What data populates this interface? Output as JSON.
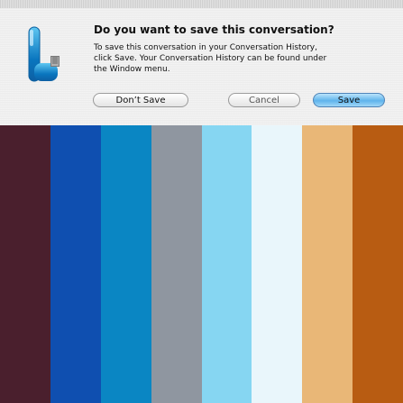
{
  "window": {
    "titlebar_text": ""
  },
  "dialog": {
    "title": "Do you want to save this conversation?",
    "body_line1": "To save this conversation in your Conversation History,",
    "body_line2": "click Save.  Your Conversation History can be found under",
    "body_line3": "the Window menu.",
    "buttons": {
      "dont_save": "Don’t Save",
      "cancel": "Cancel",
      "save": "Save"
    },
    "icon": "ichat-app-icon"
  },
  "background_stripes": {
    "colors": [
      "#4a1f2d",
      "#0f4fb0",
      "#0a86c3",
      "#8f96a0",
      "#86d6f2",
      "#e9f6fb",
      "#e9b777",
      "#b85c12"
    ]
  }
}
